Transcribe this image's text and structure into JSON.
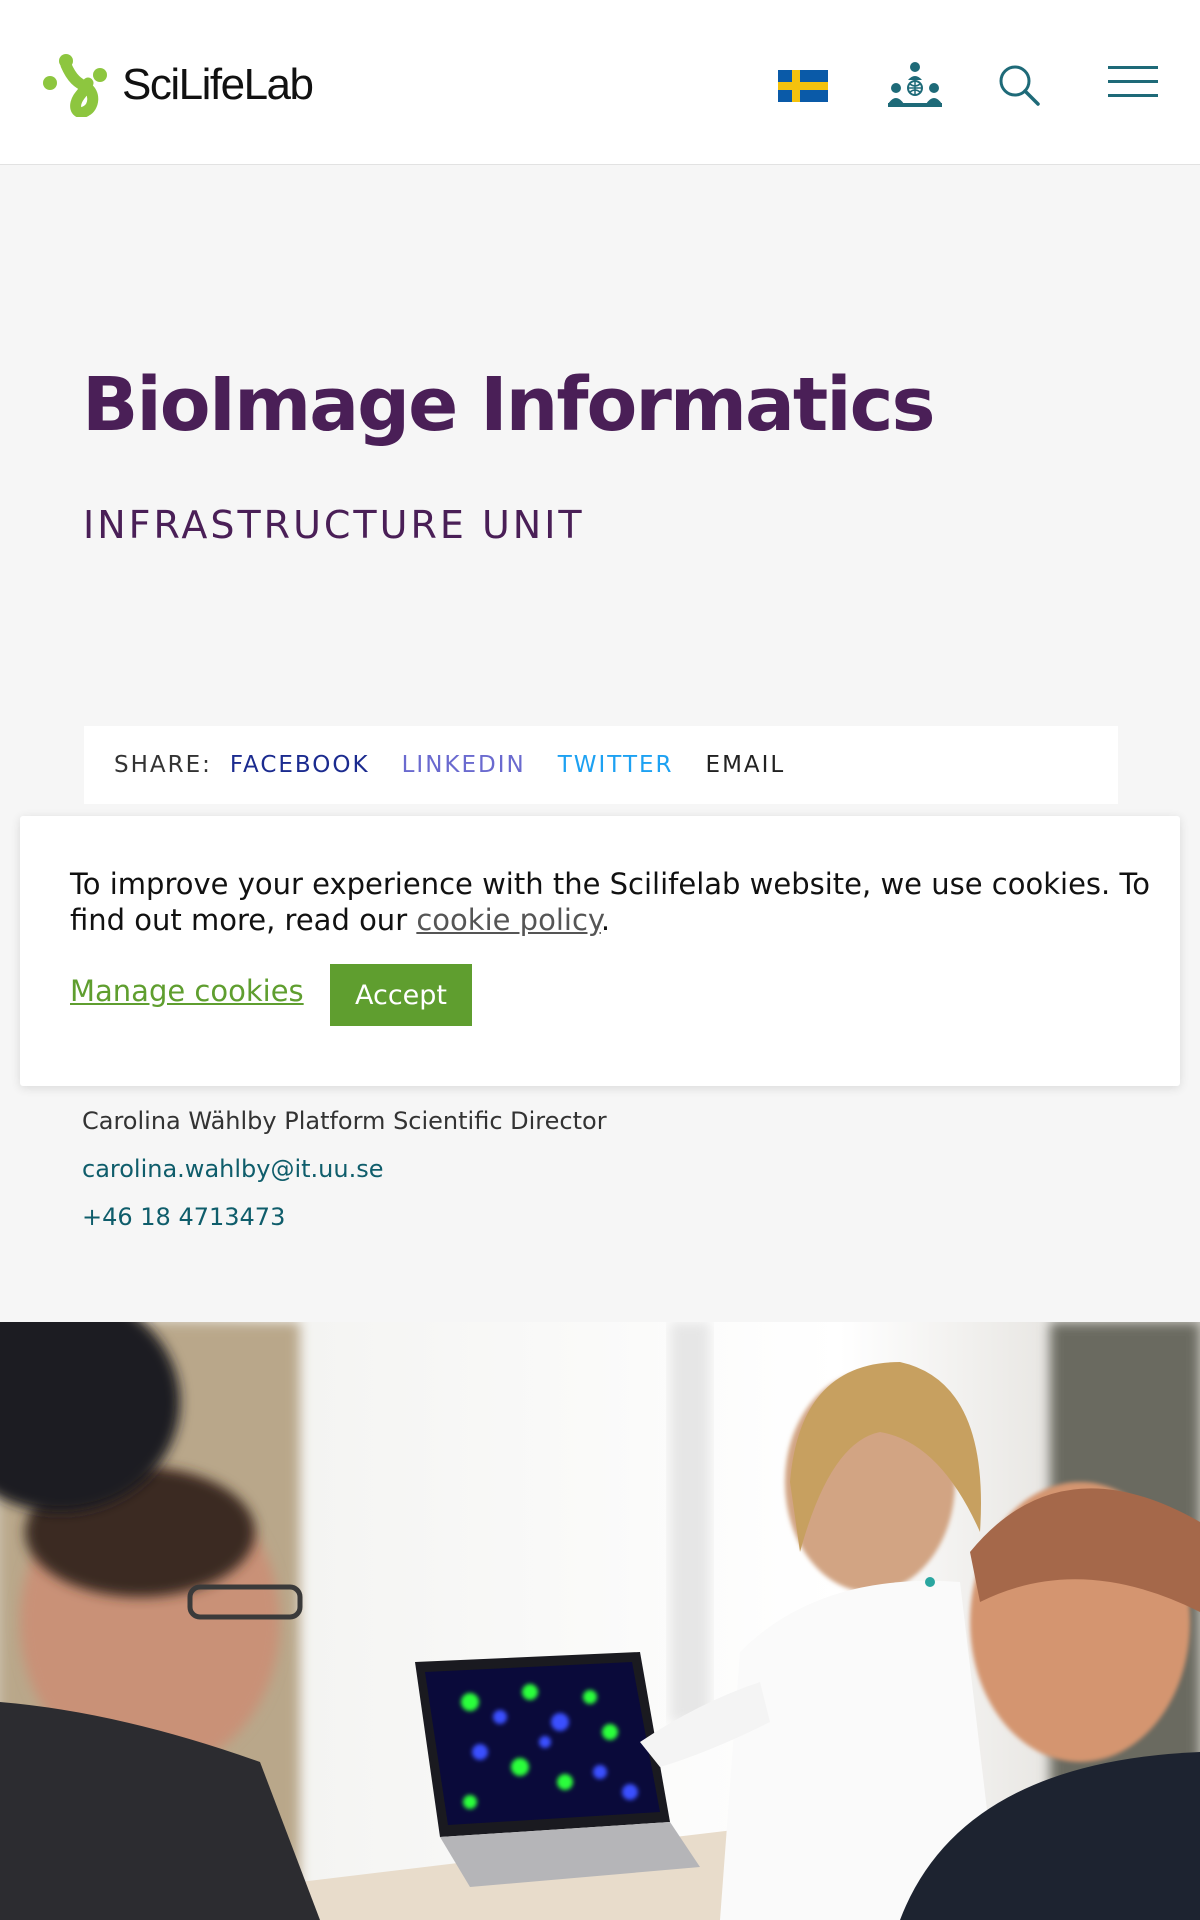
{
  "header": {
    "logo_text": "SciLifeLab",
    "icons": [
      "scilifelab-logo-icon",
      "swedish-flag-icon",
      "community-icon",
      "search-icon",
      "hamburger-menu-icon"
    ]
  },
  "hero": {
    "title": "BioImage Informatics",
    "subtitle": "INFRASTRUCTURE UNIT"
  },
  "share": {
    "label": "SHARE:",
    "facebook": "FACEBOOK",
    "linkedin": "LINKEDIN",
    "twitter": "TWITTER",
    "email": "EMAIL"
  },
  "cookie": {
    "text_before": "To improve your experience with the Scilifelab website, we use cookies. To find out more, read our ",
    "link": "cookie policy",
    "text_after": ".",
    "manage": "Manage cookies",
    "accept": "Accept"
  },
  "contact": {
    "name": "Carolina Wählby Platform Scientific Director",
    "email": "carolina.wahlby@it.uu.se",
    "phone": "+46 18 4713473"
  },
  "colors": {
    "purple": "#4a1f57",
    "green": "#5f9e2f",
    "teal": "#0f5d6b",
    "logo_green": "#8dc63f"
  }
}
